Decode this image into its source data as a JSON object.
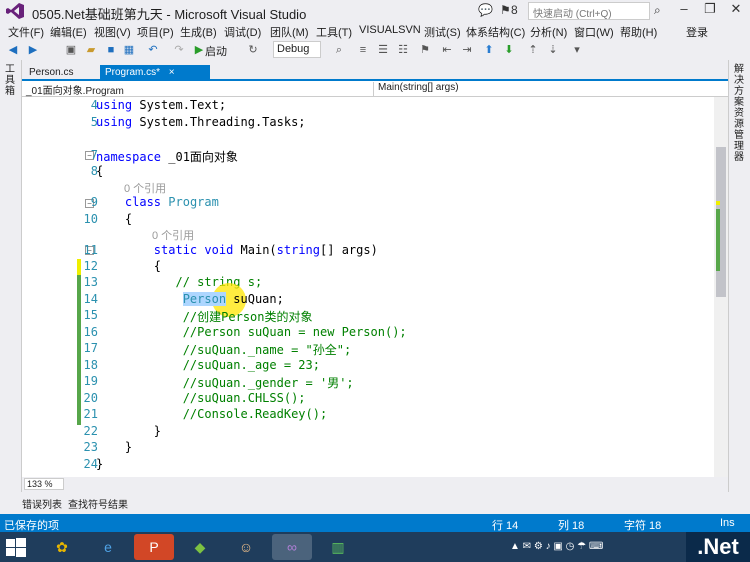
{
  "window": {
    "title": "0505.Net基础班第九天 - Microsoft Visual Studio",
    "notifications": "8",
    "quick_launch_placeholder": "快速启动 (Ctrl+Q)"
  },
  "menu": [
    "文件(F)",
    "编辑(E)",
    "视图(V)",
    "项目(P)",
    "生成(B)",
    "调试(D)",
    "团队(M)",
    "工具(T)",
    "VISUALSVN",
    "测试(S)",
    "体系结构(C)",
    "分析(N)",
    "窗口(W)",
    "帮助(H)"
  ],
  "signin": "登录",
  "toolbar": {
    "start_label": "启动",
    "config": "Debug"
  },
  "left_panel": "工具箱",
  "right_panel": "解决方案资源管理器",
  "tabs": [
    {
      "label": "Person.cs",
      "active": false
    },
    {
      "label": "Program.cs*",
      "active": true,
      "close": "×"
    }
  ],
  "navbar": {
    "class_combo": "_01面向对象.Program",
    "member_combo": "Main(string[] args)"
  },
  "editor": {
    "lines": [
      {
        "num": "4",
        "text": "using System.Text;"
      },
      {
        "num": "5",
        "text": "using System.Threading.Tasks;"
      },
      {
        "num": "7",
        "text": "namespace _01面向对象"
      },
      {
        "num": "8",
        "text": "{"
      },
      {
        "num": "9",
        "text": "    class Program",
        "lens": "0 个引用"
      },
      {
        "num": "10",
        "text": "    {"
      },
      {
        "num": "11",
        "text": "        static void Main(string[] args)",
        "lens": "0 个引用"
      },
      {
        "num": "12",
        "text": "        {"
      },
      {
        "num": "13",
        "text": "           // string s;"
      },
      {
        "num": "14",
        "text": "            Person suQuan;"
      },
      {
        "num": "15",
        "text": "            //创建Person类的对象"
      },
      {
        "num": "16",
        "text": "            //Person suQuan = new Person();"
      },
      {
        "num": "17",
        "text": "            //suQuan._name = \"孙全\";"
      },
      {
        "num": "18",
        "text": "            //suQuan._age = 23;"
      },
      {
        "num": "19",
        "text": "            //suQuan._gender = '男';"
      },
      {
        "num": "20",
        "text": "            //suQuan.CHLSS();"
      },
      {
        "num": "21",
        "text": "            //Console.ReadKey();"
      },
      {
        "num": "22",
        "text": "        }"
      },
      {
        "num": "23",
        "text": "    }"
      },
      {
        "num": "24",
        "text": "}"
      }
    ]
  },
  "zoom": "133 %",
  "bottom_tabs": [
    "错误列表",
    "查找符号结果"
  ],
  "status": {
    "message": "已保存的项",
    "line": "行 14",
    "col": "列 18",
    "ch": "字符 18",
    "mode": "Ins"
  },
  "taskbar": {
    "logo": ".Net"
  }
}
